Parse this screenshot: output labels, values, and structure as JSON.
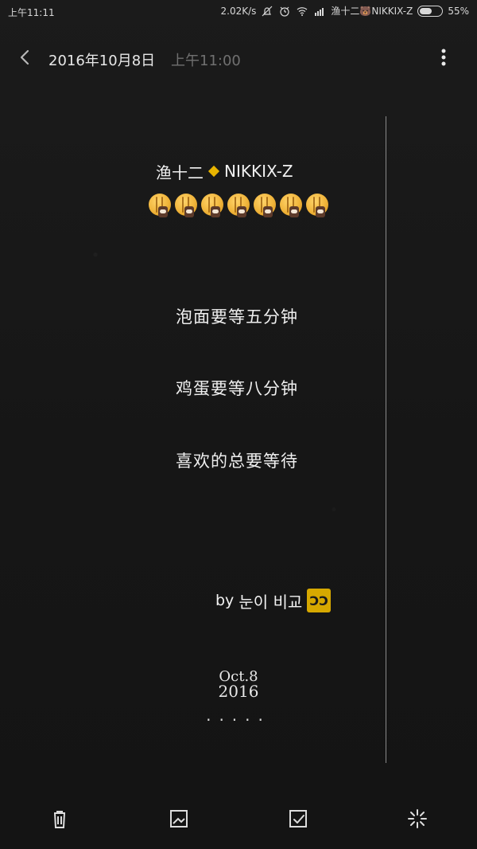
{
  "status_bar": {
    "time": "上午11:11",
    "network_speed": "2.02K/s",
    "notification_text": "渔十二🐻NIKKIX-Z",
    "battery_percent": "55%"
  },
  "top_bar": {
    "date": "2016年10月8日",
    "time": "上午11:00"
  },
  "note": {
    "title_left": "渔十二",
    "title_right": "NIKKIX-Z",
    "emoji_count": 7,
    "lines": [
      "泡面要等五分钟",
      "鸡蛋要等八分钟",
      "喜欢的总要等待"
    ],
    "signature_prefix": "by",
    "signature_name": "눈이 비교",
    "signature_badge": "ƆƆ",
    "footer_date_line1": "Oct.8",
    "footer_date_line2": "2016",
    "footer_dots": "·····"
  },
  "bottom_toolbar": {
    "items": [
      {
        "name": "delete"
      },
      {
        "name": "image"
      },
      {
        "name": "checkbox"
      },
      {
        "name": "sparkle"
      }
    ]
  },
  "colors": {
    "background": "#191919",
    "text_primary": "#efefef",
    "text_secondary": "#707070",
    "accent": "#e8b400"
  },
  "icons": {
    "back": "chevron-left-icon",
    "more": "more-vertical-icon",
    "delete": "trash-icon",
    "image": "image-icon",
    "checkbox": "checkbox-icon",
    "sparkle": "sparkle-icon"
  }
}
